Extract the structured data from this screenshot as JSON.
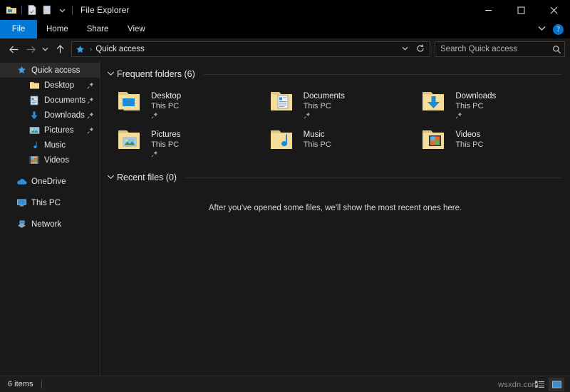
{
  "window": {
    "title": "File Explorer",
    "quick_access_toolbar": [
      {
        "name": "explorer-icon",
        "glyph": "folder"
      },
      {
        "name": "properties-icon",
        "glyph": "doc"
      },
      {
        "name": "new-folder-icon",
        "glyph": "newfolder"
      },
      {
        "name": "customize-dropdown-icon",
        "glyph": "chevron-down"
      }
    ],
    "controls": {
      "minimize": "—",
      "maximize": "☐",
      "close": "✕"
    }
  },
  "ribbon": {
    "tabs": [
      {
        "label": "File",
        "active": true
      },
      {
        "label": "Home",
        "active": false
      },
      {
        "label": "Share",
        "active": false
      },
      {
        "label": "View",
        "active": false
      }
    ],
    "collapse_chevron": "⌄",
    "help_label": "?"
  },
  "navbar": {
    "back": "←",
    "forward": "→",
    "recent_dropdown": "⌄",
    "up": "↑",
    "breadcrumb": {
      "icon": "quick-access-star",
      "label": "Quick access",
      "separator": "›"
    },
    "history_chevron": "⌄",
    "refresh": "↻",
    "search": {
      "placeholder": "Search Quick access",
      "value": "",
      "icon": "search-icon"
    }
  },
  "sidebar": {
    "items": [
      {
        "label": "Quick access",
        "icon": "star",
        "level": 0,
        "selected": true,
        "pinned": false
      },
      {
        "label": "Desktop",
        "icon": "folder-plain",
        "level": 1,
        "selected": false,
        "pinned": true
      },
      {
        "label": "Documents",
        "icon": "documents",
        "level": 1,
        "selected": false,
        "pinned": true
      },
      {
        "label": "Downloads",
        "icon": "downloads",
        "level": 1,
        "selected": false,
        "pinned": true
      },
      {
        "label": "Pictures",
        "icon": "pictures",
        "level": 1,
        "selected": false,
        "pinned": true
      },
      {
        "label": "Music",
        "icon": "music",
        "level": 1,
        "selected": false,
        "pinned": false
      },
      {
        "label": "Videos",
        "icon": "videos",
        "level": 1,
        "selected": false,
        "pinned": false
      },
      {
        "label": "OneDrive",
        "icon": "onedrive",
        "level": 0,
        "selected": false,
        "pinned": false,
        "gap_before": true
      },
      {
        "label": "This PC",
        "icon": "thispc",
        "level": 0,
        "selected": false,
        "pinned": false,
        "gap_before": true
      },
      {
        "label": "Network",
        "icon": "network",
        "level": 0,
        "selected": false,
        "pinned": false,
        "gap_before": true
      }
    ],
    "pin_glyph": "📌"
  },
  "content": {
    "groups": [
      {
        "title": "Frequent folders (6)",
        "chevron": "⌄"
      },
      {
        "title": "Recent files (0)",
        "chevron": "⌄"
      }
    ],
    "frequent_folders": [
      {
        "name": "Desktop",
        "location": "This PC",
        "icon": "folder-desktop",
        "pinned": true
      },
      {
        "name": "Documents",
        "location": "This PC",
        "icon": "folder-documents",
        "pinned": true
      },
      {
        "name": "Downloads",
        "location": "This PC",
        "icon": "folder-downloads",
        "pinned": true
      },
      {
        "name": "Pictures",
        "location": "This PC",
        "icon": "folder-pictures",
        "pinned": true
      },
      {
        "name": "Music",
        "location": "This PC",
        "icon": "folder-music",
        "pinned": false
      },
      {
        "name": "Videos",
        "location": "This PC",
        "icon": "folder-videos",
        "pinned": false
      }
    ],
    "recent_files_empty_message": "After you've opened some files, we'll show the most recent ones here."
  },
  "statusbar": {
    "item_count": "6 items",
    "view_details_icon": "details-view-icon",
    "view_large_icons_icon": "large-icons-view-icon"
  },
  "watermark": "wsxdn.com",
  "colors": {
    "accent": "#0078d7",
    "window_bg": "#191919",
    "titlebar_bg": "#000000",
    "folder_yellow": "#f1d68a",
    "text_primary": "#e8e8e8"
  }
}
